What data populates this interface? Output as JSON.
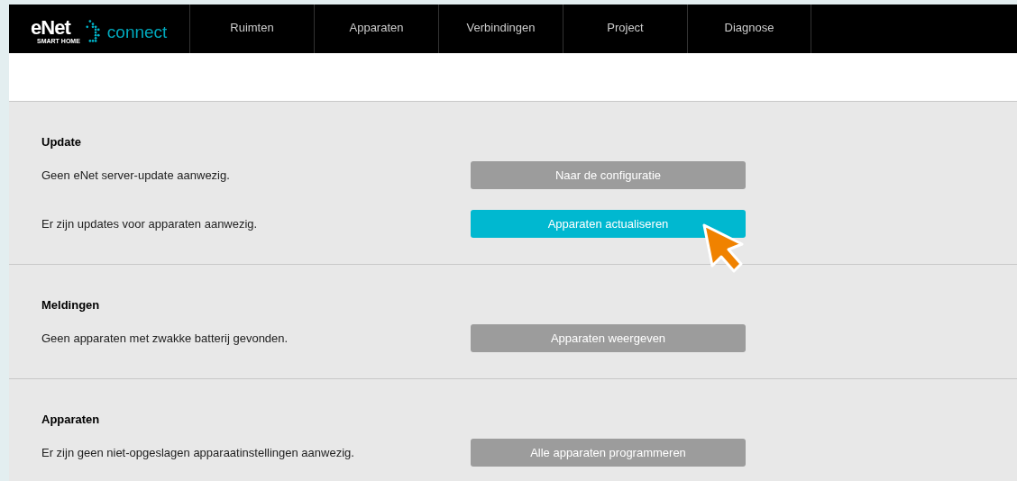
{
  "logo": {
    "wordmark": "eNet",
    "tagline": "SMART HOME",
    "product": "connect"
  },
  "nav": [
    {
      "label": "Ruimten",
      "selected": false
    },
    {
      "label": "Apparaten",
      "selected": false
    },
    {
      "label": "Verbindingen",
      "selected": false
    },
    {
      "label": "Project",
      "selected": false
    },
    {
      "label": "Diagnose",
      "selected": false
    }
  ],
  "sections": [
    {
      "title": "Update",
      "rows": [
        {
          "text": "Geen eNet server-update aanwezig.",
          "button": "Naar de configuratie",
          "disabled": true
        },
        {
          "text": "Er zijn updates voor apparaten aanwezig.",
          "button": "Apparaten actualiseren",
          "disabled": false
        }
      ]
    },
    {
      "title": "Meldingen",
      "rows": [
        {
          "text": "Geen apparaten met zwakke batterij gevonden.",
          "button": "Apparaten weergeven",
          "disabled": true
        }
      ]
    },
    {
      "title": "Apparaten",
      "rows": [
        {
          "text": "Er zijn geen niet-opgeslagen apparaatinstellingen aanwezig.",
          "button": "Alle apparaten programmeren",
          "disabled": true
        }
      ]
    }
  ]
}
